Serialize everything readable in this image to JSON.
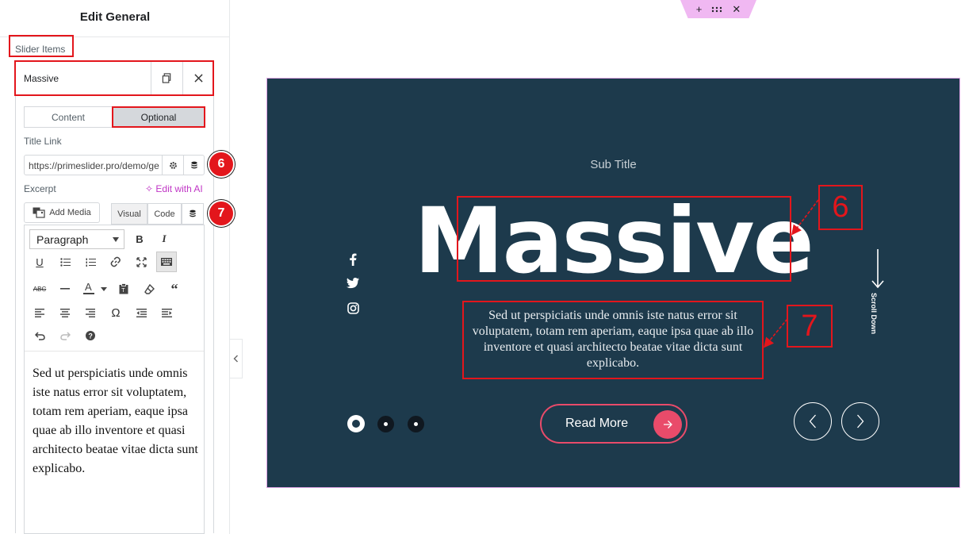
{
  "panel": {
    "title": "Edit General",
    "slider_items_label": "Slider Items",
    "item_title": "Massive",
    "tabs": {
      "content": "Content",
      "optional": "Optional"
    },
    "title_link_label": "Title Link",
    "title_link_value": "https://primeslider.pro/demo/ge",
    "excerpt_label": "Excerpt",
    "edit_with_ai": "Edit with AI",
    "add_media": "Add Media",
    "visual_tab": "Visual",
    "code_tab": "Code",
    "format_select": "Paragraph",
    "editor_text": "Sed ut perspiciatis unde omnis iste natus error sit voluptatem, totam rem aperiam, eaque ipsa quae ab illo inventore et quasi architecto beatae vitae dicta sunt explicabo."
  },
  "annotations": {
    "badge_6": "6",
    "badge_7": "7"
  },
  "slider": {
    "sub_title": "Sub Title",
    "title": "Massive",
    "excerpt": "Sed ut perspiciatis unde omnis iste natus error sit voluptatem, totam rem aperiam, eaque ipsa quae ab illo inventore et quasi architecto beatae vitae dicta sunt explicabo.",
    "read_more": "Read More",
    "scroll_down": "Scroll Down",
    "social_icons": [
      "facebook-icon",
      "twitter-icon",
      "instagram-icon"
    ],
    "active_dot": 1,
    "dots_count": 3
  },
  "colors": {
    "slider_bg": "#1d3a4c",
    "accent": "#e94b6a",
    "annotation": "#e3161c",
    "ai_link": "#c036c5",
    "section_handle": "#f0b8f2"
  }
}
